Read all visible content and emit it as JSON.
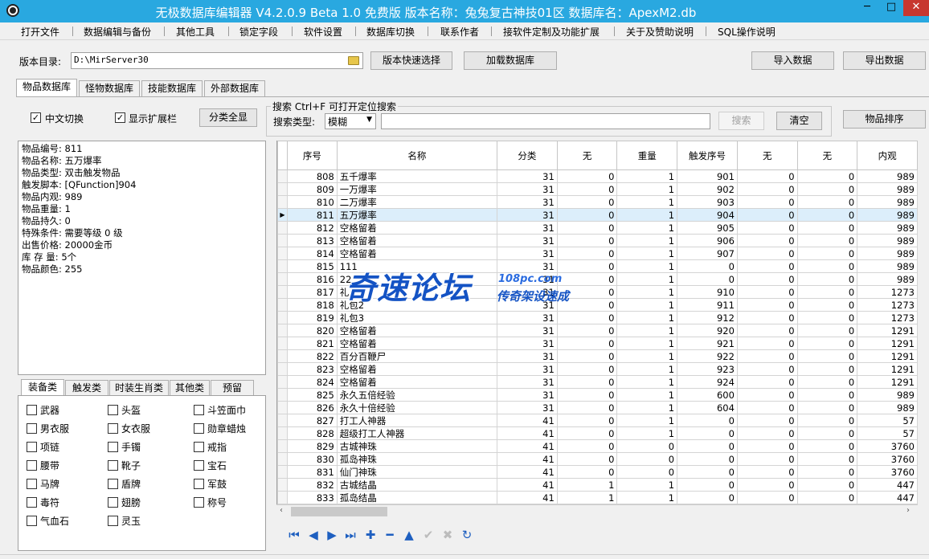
{
  "window": {
    "title": "无极数据库编辑器 V4.2.0.9   Beta 1.0 免费版    版本名称：兔兔复古神技01区    数据库名：ApexM2.db",
    "min": "─",
    "max": "□",
    "close": "✕"
  },
  "menu": [
    "打开文件",
    "数据编辑与备份",
    "其他工具",
    "锁定字段",
    "软件设置",
    "数据库切换",
    "联系作者",
    "接软件定制及功能扩展",
    "关于及赞助说明",
    "SQL操作说明"
  ],
  "toolbar": {
    "version_dir_label": "版本目录:",
    "version_dir_value": "D:\\MirServer30",
    "quick_select": "版本快速选择",
    "load_db": "加载数据库",
    "import": "导入数据",
    "export": "导出数据"
  },
  "db_tabs": [
    "物品数据库",
    "怪物数据库",
    "技能数据库",
    "外部数据库"
  ],
  "options": {
    "chinese_switch": "中文切换",
    "show_ext": "显示扩展栏",
    "show_all": "分类全显"
  },
  "search": {
    "group_label": "搜索  Ctrl+F 可打开定位搜索",
    "type_label": "搜索类型:",
    "type_value": "模糊",
    "query": "",
    "search_btn": "搜索",
    "clear_btn": "清空",
    "sort_btn": "物品排序"
  },
  "info": [
    "物品编号: 811",
    "物品名称: 五万爆率",
    "物品类型: 双击触发物品",
    "触发脚本: [QFunction]904",
    "物品内观: 989",
    "物品重量: 1",
    "物品持久: 0",
    "特殊条件: 需要等级 0 级",
    "出售价格: 20000金币",
    "库 存 量: 5个",
    "物品颜色: 255"
  ],
  "cat_tabs": [
    "装备类",
    "触发类",
    "时装生肖类",
    "其他类",
    "预留"
  ],
  "categories": [
    [
      "武器",
      "头盔",
      "斗笠面巾"
    ],
    [
      "男衣服",
      "女衣服",
      "勋章蜡烛"
    ],
    [
      "项链",
      "手镯",
      "戒指"
    ],
    [
      "腰带",
      "靴子",
      "宝石"
    ],
    [
      "马牌",
      "盾牌",
      "军鼓"
    ],
    [
      "毒符",
      "翅膀",
      "称号"
    ],
    [
      "气血石",
      "灵玉",
      ""
    ]
  ],
  "grid": {
    "columns": [
      "序号",
      "名称",
      "分类",
      "无",
      "重量",
      "触发序号",
      "无",
      "无",
      "内观"
    ],
    "selected_row": 3,
    "rows": [
      [
        "808",
        "五千爆率",
        "31",
        "0",
        "1",
        "901",
        "0",
        "0",
        "989"
      ],
      [
        "809",
        "一万爆率",
        "31",
        "0",
        "1",
        "902",
        "0",
        "0",
        "989"
      ],
      [
        "810",
        "二万爆率",
        "31",
        "0",
        "1",
        "903",
        "0",
        "0",
        "989"
      ],
      [
        "811",
        "五万爆率",
        "31",
        "0",
        "1",
        "904",
        "0",
        "0",
        "989"
      ],
      [
        "812",
        "空格留着",
        "31",
        "0",
        "1",
        "905",
        "0",
        "0",
        "989"
      ],
      [
        "813",
        "空格留着",
        "31",
        "0",
        "1",
        "906",
        "0",
        "0",
        "989"
      ],
      [
        "814",
        "空格留着",
        "31",
        "0",
        "1",
        "907",
        "0",
        "0",
        "989"
      ],
      [
        "815",
        "111",
        "31",
        "0",
        "1",
        "0",
        "0",
        "0",
        "989"
      ],
      [
        "816",
        "22",
        "31",
        "0",
        "1",
        "0",
        "0",
        "0",
        "989"
      ],
      [
        "817",
        "礼",
        "31",
        "0",
        "1",
        "910",
        "0",
        "0",
        "1273"
      ],
      [
        "818",
        "礼包2",
        "31",
        "0",
        "1",
        "911",
        "0",
        "0",
        "1273"
      ],
      [
        "819",
        "礼包3",
        "31",
        "0",
        "1",
        "912",
        "0",
        "0",
        "1273"
      ],
      [
        "820",
        "空格留着",
        "31",
        "0",
        "1",
        "920",
        "0",
        "0",
        "1291"
      ],
      [
        "821",
        "空格留着",
        "31",
        "0",
        "1",
        "921",
        "0",
        "0",
        "1291"
      ],
      [
        "822",
        "百分百鞭尸",
        "31",
        "0",
        "1",
        "922",
        "0",
        "0",
        "1291"
      ],
      [
        "823",
        "空格留着",
        "31",
        "0",
        "1",
        "923",
        "0",
        "0",
        "1291"
      ],
      [
        "824",
        "空格留着",
        "31",
        "0",
        "1",
        "924",
        "0",
        "0",
        "1291"
      ],
      [
        "825",
        "永久五倍经验",
        "31",
        "0",
        "1",
        "600",
        "0",
        "0",
        "989"
      ],
      [
        "826",
        "永久十倍经验",
        "31",
        "0",
        "1",
        "604",
        "0",
        "0",
        "989"
      ],
      [
        "827",
        "打工人神器",
        "41",
        "0",
        "1",
        "0",
        "0",
        "0",
        "57"
      ],
      [
        "828",
        "超级打工人神器",
        "41",
        "0",
        "1",
        "0",
        "0",
        "0",
        "57"
      ],
      [
        "829",
        "古城神珠",
        "41",
        "0",
        "0",
        "0",
        "0",
        "0",
        "3760"
      ],
      [
        "830",
        "孤岛神珠",
        "41",
        "0",
        "0",
        "0",
        "0",
        "0",
        "3760"
      ],
      [
        "831",
        "仙门神珠",
        "41",
        "0",
        "0",
        "0",
        "0",
        "0",
        "3760"
      ],
      [
        "832",
        "古城结晶",
        "41",
        "1",
        "1",
        "0",
        "0",
        "0",
        "447"
      ],
      [
        "833",
        "孤岛结晶",
        "41",
        "1",
        "1",
        "0",
        "0",
        "0",
        "447"
      ]
    ]
  },
  "nav_icons": [
    "first-icon",
    "prior-icon",
    "next-icon",
    "last-icon",
    "insert-icon",
    "delete-icon",
    "edit-icon",
    "post-icon",
    "cancel-icon",
    "refresh-icon"
  ],
  "watermark": {
    "main": "奇速论坛",
    "url": "108pc.com",
    "sub": "传奇架设速成"
  }
}
